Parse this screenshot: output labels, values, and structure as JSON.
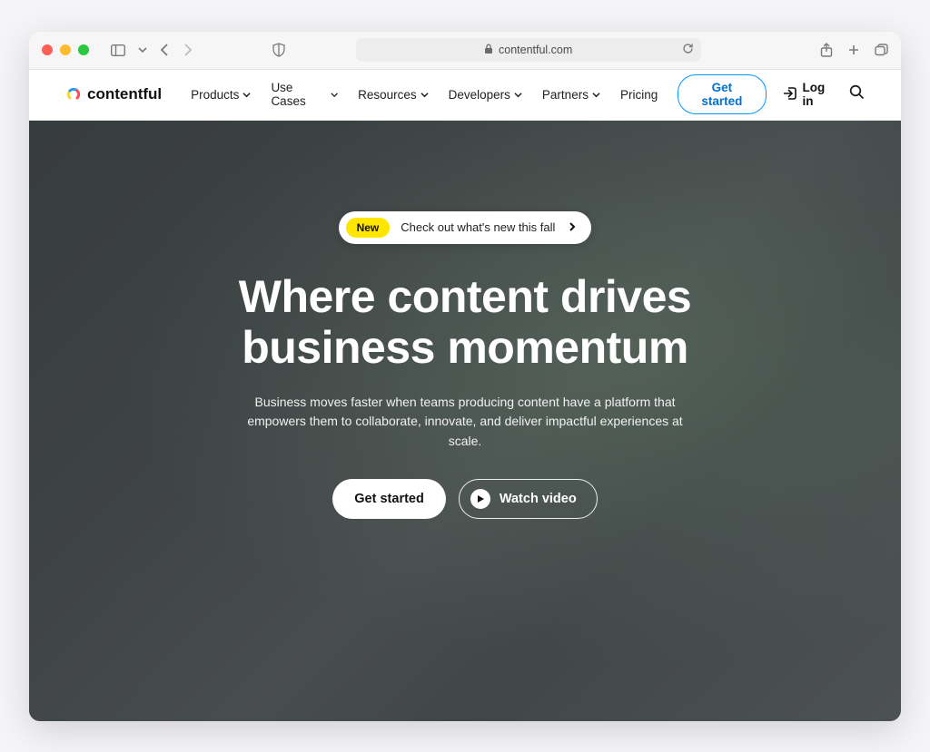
{
  "browser": {
    "url_display": "contentful.com"
  },
  "nav": {
    "brand": "contentful",
    "items": [
      {
        "label": "Products",
        "has_chevron": true
      },
      {
        "label": "Use Cases",
        "has_chevron": true
      },
      {
        "label": "Resources",
        "has_chevron": true
      },
      {
        "label": "Developers",
        "has_chevron": true
      },
      {
        "label": "Partners",
        "has_chevron": true
      },
      {
        "label": "Pricing",
        "has_chevron": false
      }
    ],
    "cta": "Get started",
    "login": "Log in"
  },
  "hero": {
    "announce_badge": "New",
    "announce_text": "Check out what's new this fall",
    "title": "Where content drives business momentum",
    "subtitle": "Business moves faster when teams producing content have a platform that empowers them to collaborate, innovate, and deliver impactful experiences at scale.",
    "primary_cta": "Get started",
    "video_cta": "Watch video"
  }
}
